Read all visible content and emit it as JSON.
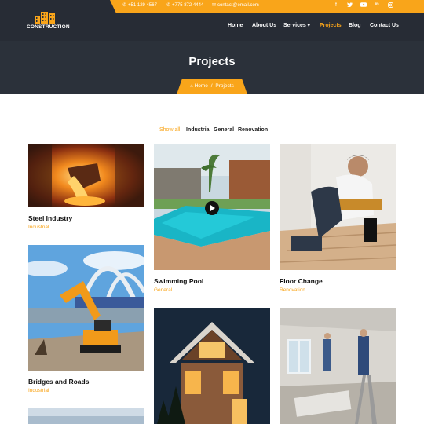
{
  "topbar": {
    "phone1": "+51 129 4567",
    "phone2": "+775 872 4444",
    "email": "contact@email.com",
    "social": [
      "facebook-icon",
      "twitter-icon",
      "youtube-icon",
      "linkedin-icon",
      "instagram-icon"
    ]
  },
  "logo": {
    "text": "CONSTRUCTION"
  },
  "nav": {
    "items": [
      "Home",
      "About Us",
      "Services",
      "Projects",
      "Blog",
      "Contact Us"
    ],
    "active": "Projects"
  },
  "hero": {
    "title": "Projects",
    "breadcrumb": {
      "home": "Home",
      "sep": "/",
      "current": "Projects"
    }
  },
  "filters": {
    "items": [
      "Show all",
      "Industrial",
      "General",
      "Renovation"
    ],
    "active": "Show all"
  },
  "projects": [
    {
      "title": "Steel Industry",
      "category": "Industrial"
    },
    {
      "title": "Swimming Pool",
      "category": "General"
    },
    {
      "title": "Floor Change",
      "category": "Renovation"
    },
    {
      "title": "Bridges and Roads",
      "category": "Industrial"
    }
  ],
  "colors": {
    "accent": "#f9a51a",
    "header": "#272c35",
    "hero": "#2b313a"
  }
}
